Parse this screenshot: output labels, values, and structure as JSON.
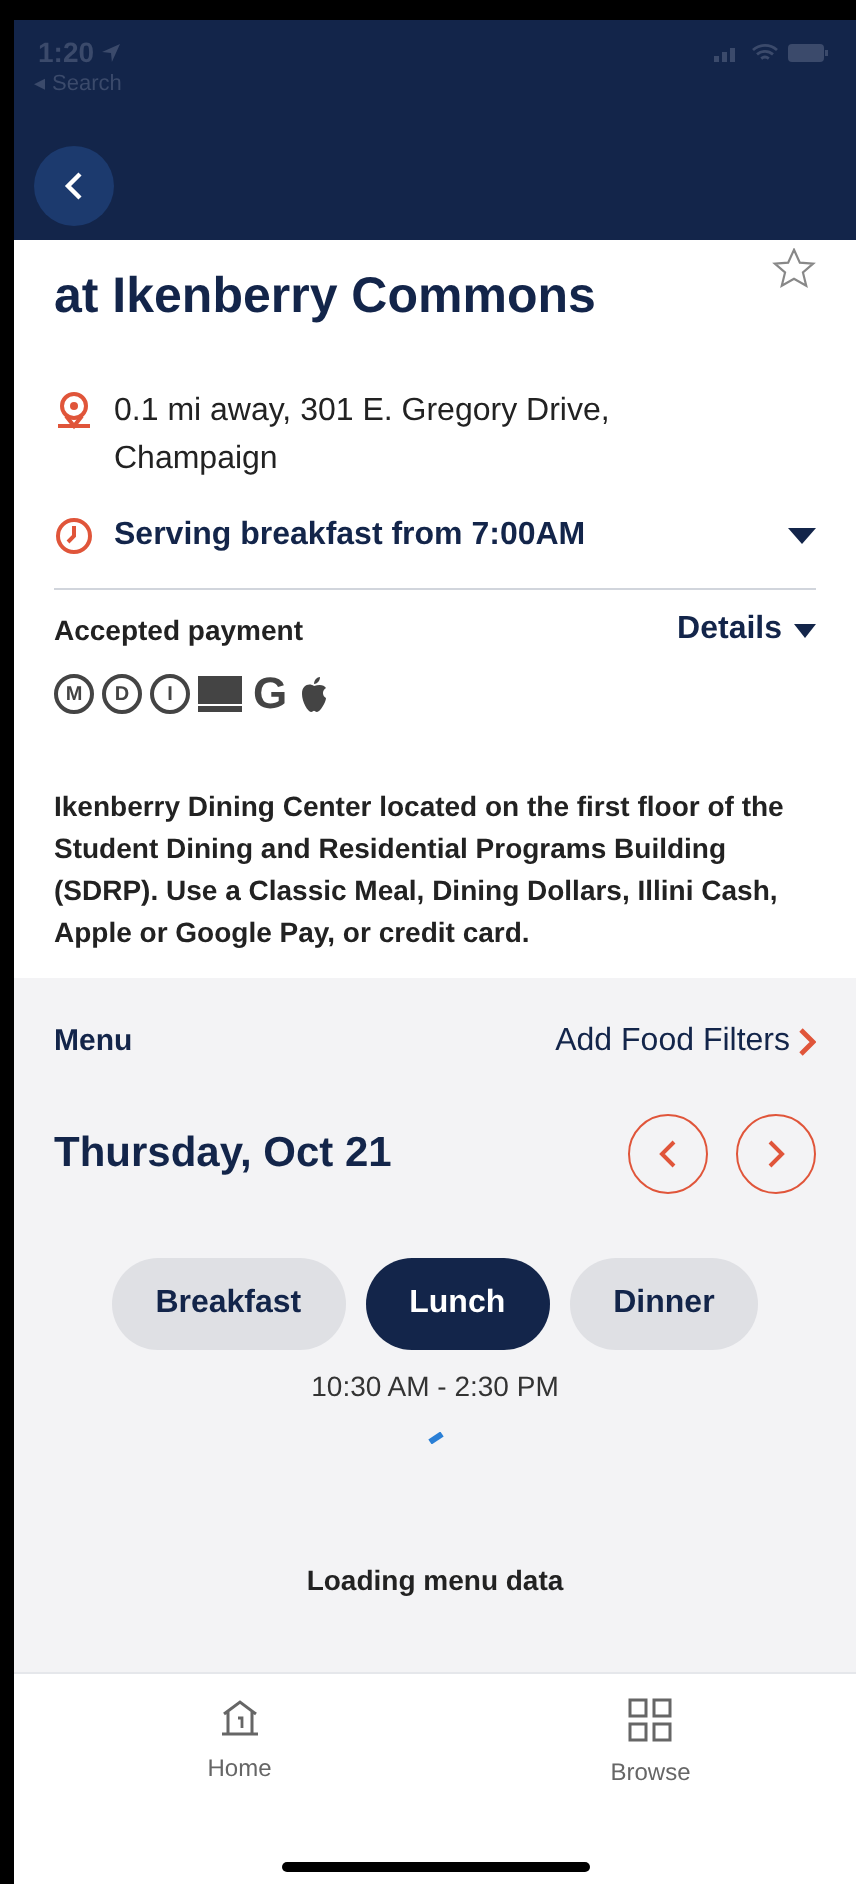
{
  "status_bar": {
    "time": "1:20",
    "back_label": "◂ Search"
  },
  "header": {
    "title": "at Ikenberry Commons",
    "favorite": false
  },
  "location": {
    "text": "0.1 mi away, 301 E. Gregory Drive, Champaign"
  },
  "hours": {
    "text": "Serving breakfast from 7:00AM",
    "expanded": false
  },
  "payment": {
    "label": "Accepted payment",
    "details": "Details",
    "methods": [
      {
        "kind": "letter",
        "symbol": "M"
      },
      {
        "kind": "letter",
        "symbol": "D"
      },
      {
        "kind": "letter",
        "symbol": "I"
      },
      {
        "kind": "card"
      },
      {
        "kind": "plain",
        "symbol": "G"
      },
      {
        "kind": "apple"
      }
    ]
  },
  "description": "Ikenberry Dining Center located on the first floor of the Student Dining and Residential Programs Building (SDRP). Use a Classic Meal, Dining Dollars, Illini Cash, Apple or Google Pay, or credit card.",
  "menu": {
    "label": "Menu",
    "filters": "Add Food Filters",
    "date": "Thursday, Oct 21",
    "meals": [
      {
        "label": "Breakfast",
        "selected": false
      },
      {
        "label": "Lunch",
        "selected": true
      },
      {
        "label": "Dinner",
        "selected": false
      }
    ],
    "hours": "10:30 AM - 2:30 PM",
    "status": "Loading menu data"
  },
  "tab_bar": [
    {
      "kind": "home",
      "label": "Home"
    },
    {
      "kind": "browse",
      "label": "Browse"
    }
  ]
}
